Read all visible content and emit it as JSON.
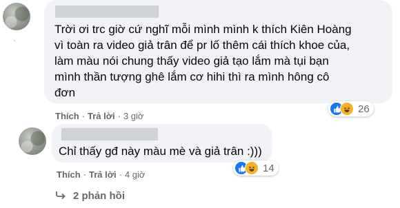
{
  "comments": [
    {
      "text_lines": [
        "Trời ơi trc giờ cứ nghĩ mỗi mình mình k thích Kiên Hoàng",
        "vì toàn ra video giả trân để pr lố thêm cái thích khoe của,",
        "làm màu nói chung thấy video giả tạo lắm mà tụi bạn",
        "mình thần tượng ghê lắm cơ hihi thì ra mình hông cô",
        "đơn"
      ],
      "actions": {
        "like": "Thích",
        "reply": "Trả lời",
        "time": "3 giờ"
      },
      "reactions": {
        "icons": [
          "like-icon",
          "haha-icon"
        ],
        "count": "26"
      }
    },
    {
      "text_lines": [
        "Chỉ thấy gđ này màu mè và giả trân :)))"
      ],
      "actions": {
        "like": "Thích",
        "reply": "Trả lời",
        "time": "4 giờ"
      },
      "reactions": {
        "icons": [
          "like-icon",
          "haha-icon"
        ],
        "count": "14"
      }
    }
  ],
  "replies": {
    "label": "2 phản hồi"
  },
  "colors": {
    "bubble": "#f0f2f5",
    "secondary_text": "#65676b",
    "like_blue": "#1877f2",
    "haha_yellow": "#f7b125"
  }
}
